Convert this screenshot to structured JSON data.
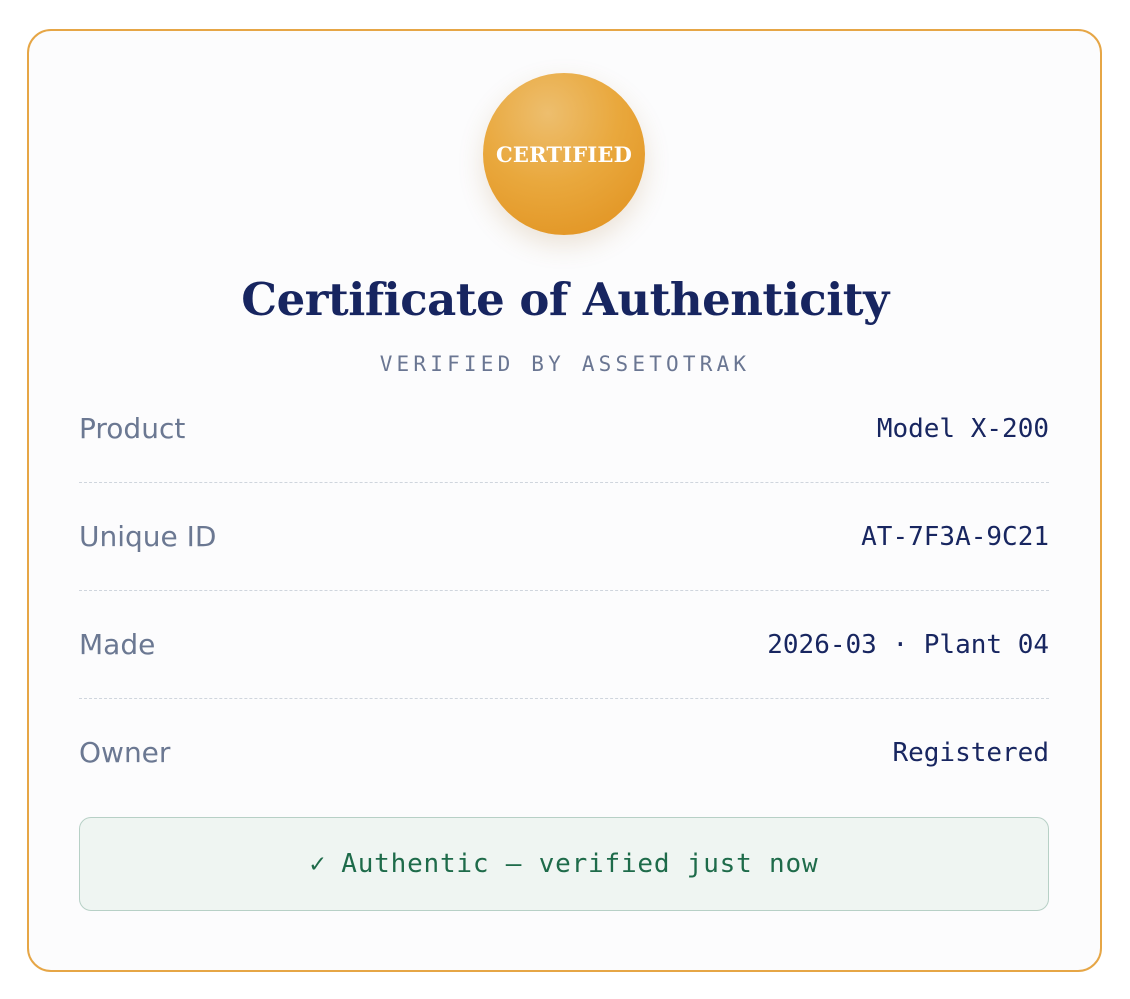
{
  "seal": {
    "label": "CERTIFIED",
    "color": "#e9a83d"
  },
  "certificate": {
    "title": "Certificate of Authenticity",
    "subtitle": "VERIFIED BY ASSETOTRAK"
  },
  "details": [
    {
      "label": "Product",
      "value": "Model X-200"
    },
    {
      "label": "Unique ID",
      "value": "AT-7F3A-9C21"
    },
    {
      "label": "Made",
      "value": "2026-03 · Plant 04"
    },
    {
      "label": "Owner",
      "value": "Registered"
    }
  ],
  "status": {
    "icon": "check-icon",
    "check": "✓",
    "text": "Authentic — verified just now",
    "color": "#1e6b4a"
  },
  "colors": {
    "accent_border": "#e6a646",
    "title": "#172560"
  }
}
